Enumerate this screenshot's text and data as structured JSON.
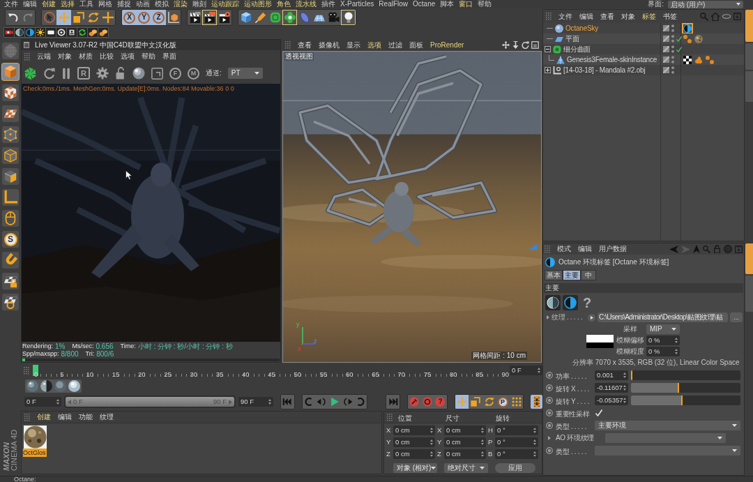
{
  "menu_bar": {
    "items": [
      {
        "label": "文件",
        "highlighted": false
      },
      {
        "label": "编辑",
        "highlighted": false
      },
      {
        "label": "创建",
        "highlighted": true
      },
      {
        "label": "选择",
        "highlighted": true
      },
      {
        "label": "工具",
        "highlighted": false
      },
      {
        "label": "网格",
        "highlighted": false
      },
      {
        "label": "捕捉",
        "highlighted": false
      },
      {
        "label": "动画",
        "highlighted": false
      },
      {
        "label": "模拟",
        "highlighted": false
      },
      {
        "label": "渲染",
        "highlighted": true
      },
      {
        "label": "雕刻",
        "highlighted": false
      },
      {
        "label": "运动跟踪",
        "highlighted": true
      },
      {
        "label": "运动图形",
        "highlighted": true
      },
      {
        "label": "角色",
        "highlighted": true
      },
      {
        "label": "流水线",
        "highlighted": true
      },
      {
        "label": "插件",
        "highlighted": false
      },
      {
        "label": "X-Particles",
        "highlighted": false
      },
      {
        "label": "RealFlow",
        "highlighted": false
      },
      {
        "label": "Octane",
        "highlighted": false
      },
      {
        "label": "脚本",
        "highlighted": false
      },
      {
        "label": "窗口",
        "highlighted": true
      },
      {
        "label": "帮助",
        "highlighted": false
      }
    ],
    "layout_label": "界面:",
    "layout_value": "启动 (用户)"
  },
  "main_toolbar": [
    {
      "selected": false,
      "highlighted": false,
      "disabled": false
    },
    {
      "selected": false,
      "highlighted": false,
      "disabled": true
    },
    {
      "selected": false,
      "highlighted": false,
      "disabled": false
    },
    {
      "selected": true,
      "highlighted": false,
      "disabled": false
    },
    {
      "selected": false,
      "highlighted": false,
      "disabled": false
    },
    {
      "selected": false,
      "highlighted": false,
      "disabled": false
    },
    {
      "selected": false,
      "highlighted": false,
      "disabled": false
    },
    {
      "label": "X",
      "selected": true,
      "highlighted": false,
      "disabled": false
    },
    {
      "label": "Y",
      "selected": true,
      "highlighted": false,
      "disabled": false
    },
    {
      "label": "Z",
      "selected": true,
      "highlighted": false,
      "disabled": false
    },
    {
      "selected": false,
      "highlighted": false,
      "disabled": false
    },
    {
      "selected": false,
      "highlighted": false,
      "disabled": false
    },
    {
      "selected": false,
      "highlighted": true,
      "disabled": false
    },
    {
      "selected": false,
      "highlighted": false,
      "disabled": false
    },
    {
      "selected": false,
      "highlighted": false,
      "disabled": false
    },
    {
      "selected": false,
      "highlighted": false,
      "disabled": false
    },
    {
      "selected": false,
      "highlighted": false,
      "disabled": false
    },
    {
      "selected": false,
      "highlighted": true,
      "disabled": false
    },
    {
      "selected": false,
      "highlighted": false,
      "disabled": false
    },
    {
      "selected": false,
      "highlighted": false,
      "disabled": false
    },
    {
      "selected": false,
      "highlighted": false,
      "disabled": false
    },
    {
      "selected": false,
      "highlighted": true,
      "disabled": false
    }
  ],
  "left_toolbar": [
    {
      "selected": false,
      "disabled": true
    },
    {
      "selected": true,
      "disabled": false
    },
    {
      "selected": false,
      "disabled": false
    },
    {
      "selected": false,
      "disabled": false
    },
    {
      "selected": false,
      "disabled": false
    },
    {
      "selected": false,
      "disabled": false
    },
    {
      "selected": false,
      "disabled": false
    },
    {
      "selected": false,
      "disabled": false
    },
    {
      "selected": false,
      "disabled": false
    },
    {
      "label": "S",
      "selected": false,
      "disabled": false
    },
    {
      "selected": false,
      "disabled": false
    },
    {
      "selected": false,
      "disabled": false
    },
    {
      "selected": false,
      "disabled": false
    }
  ],
  "live_viewer": {
    "title": "Live Viewer 3.07-R2 中国C4D联盟中文汉化版",
    "menu": [
      "云端",
      "对象",
      "材质",
      "比较",
      "选项",
      "帮助",
      "界面"
    ],
    "letter_button": "R",
    "pins": [
      "F",
      "M"
    ],
    "channel_label": "通道:",
    "channel_value": "PT",
    "status_line": "Check:0ms./1ms. MeshGen:0ms. Update[E]:0ms. Nodes:84 Movable:36  0 0",
    "stats": [
      {
        "label": "Rendering:",
        "value": "1%"
      },
      {
        "label": "Ms/sec:",
        "value": "0.656"
      },
      {
        "label": "Time:",
        "value": "小时 : 分钟 : 秒/小时 : 分钟 : 秒"
      },
      {
        "label": "Spp/maxspp:",
        "value": "8/800"
      },
      {
        "label": "Tri:",
        "value": "800/6"
      }
    ],
    "progress": {
      "level": 0.01
    }
  },
  "viewport": {
    "menu": [
      {
        "label": "查看",
        "highlighted": false
      },
      {
        "label": "摄像机",
        "highlighted": false
      },
      {
        "label": "显示",
        "highlighted": false
      },
      {
        "label": "选项",
        "highlighted": true
      },
      {
        "label": "过滤",
        "highlighted": false
      },
      {
        "label": "面板",
        "highlighted": false
      },
      {
        "label": "ProRender",
        "highlighted": true
      }
    ],
    "view_label": "透视视图",
    "grid_spacing": "网格间距 : 10 cm",
    "axis_labels": [
      "y",
      "z",
      "x"
    ]
  },
  "timeline": {
    "ticks": [
      "0",
      "5",
      "10",
      "15",
      "20",
      "25",
      "30",
      "35",
      "40",
      "45",
      "50",
      "55",
      "60",
      "65",
      "70",
      "75",
      "80",
      "85",
      "90"
    ],
    "playhead": {
      "level": 0
    },
    "frame": "0 F"
  },
  "transport": {
    "start": "0 F",
    "range": {
      "level": 1
    },
    "range_start": "0 F",
    "range_end": "90 F",
    "end": "90 F",
    "help_label": "?",
    "modes": [
      {
        "selected": true
      },
      {
        "selected": false
      },
      {
        "selected": false
      },
      {
        "label": "P",
        "selected": false
      },
      {
        "selected": false
      }
    ],
    "film": {
      "selected": true
    }
  },
  "materials": {
    "menu": [
      {
        "label": "创建",
        "highlighted": true
      },
      {
        "label": "编辑",
        "highlighted": false
      },
      {
        "label": "功能",
        "highlighted": false
      },
      {
        "label": "纹理",
        "highlighted": false
      }
    ],
    "items": [
      {
        "name": "OctGlos",
        "selected": true
      }
    ]
  },
  "coordinates": {
    "headers": [
      "位置",
      "尺寸",
      "旋转"
    ],
    "rows": [
      [
        {
          "axis": "X",
          "value": "0 cm"
        },
        {
          "axis": "X",
          "value": "0 cm"
        },
        {
          "axis": "H",
          "value": "0 °"
        }
      ],
      [
        {
          "axis": "Y",
          "value": "0 cm"
        },
        {
          "axis": "Y",
          "value": "0 cm"
        },
        {
          "axis": "P",
          "value": "0 °"
        }
      ],
      [
        {
          "axis": "Z",
          "value": "0 cm"
        },
        {
          "axis": "Z",
          "value": "0 cm"
        },
        {
          "axis": "B",
          "value": "0 °"
        }
      ]
    ],
    "mode": "对象 (相对)",
    "size_mode": "绝对尺寸",
    "apply": "应用"
  },
  "logo": {
    "brand": "MAXON",
    "product": "CINEMA 4D"
  },
  "object_manager": {
    "menu": [
      {
        "label": "文件",
        "highlighted": false
      },
      {
        "label": "编辑",
        "highlighted": false
      },
      {
        "label": "查看",
        "highlighted": false
      },
      {
        "label": "对象",
        "highlighted": false
      },
      {
        "label": "标签",
        "highlighted": true
      },
      {
        "label": "书签",
        "highlighted": false
      }
    ],
    "objects": [
      {
        "name": "OctaneSky",
        "kind": "sky",
        "selected": true,
        "checked": false,
        "tags": [
          {
            "kind": "environment",
            "selected": true
          }
        ]
      },
      {
        "name": "平面",
        "kind": "plane",
        "selected": false,
        "checked": true,
        "tags": [
          {
            "kind": "dots",
            "selected": false
          },
          {
            "kind": "material",
            "selected": false
          }
        ]
      },
      {
        "name": "细分曲面",
        "kind": "subdivision",
        "selected": false,
        "checked": true,
        "expanded": true,
        "children": [
          {
            "name": "Genesis3Female-skinInstance",
            "kind": "polygon",
            "selected": false,
            "checked": false,
            "tags": [
              {
                "kind": "checker",
                "selected": false
              },
              {
                "kind": "blob",
                "selected": false
              },
              {
                "kind": "dots",
                "selected": false
              }
            ]
          }
        ]
      },
      {
        "name": "[14-03-18] - Mandala #2.obj",
        "kind": "null",
        "selected": false,
        "checked": false,
        "expanded": false
      }
    ]
  },
  "attributes": {
    "menu": [
      "模式",
      "编辑",
      "用户数据"
    ],
    "title": "Octane 环境标签 [Octane 环境标签]",
    "tabs": [
      {
        "label": "基本",
        "selected": false
      },
      {
        "label": "主要",
        "selected": true
      },
      {
        "label": "中",
        "selected": false
      }
    ],
    "section": "主要",
    "help": "?",
    "texture": {
      "label": "纹理 . . . . .",
      "path": "C:\\Users\\Administrator\\Desktop\\贴图纹理\\贴",
      "button": "..."
    },
    "sampling": {
      "label": "采样",
      "value": "MIP"
    },
    "blur_offset": {
      "label": "模糊偏移",
      "value": "0 %"
    },
    "blur_amount": {
      "label": "模糊程度",
      "value": "0 %"
    },
    "resolution": "分辨率 7070 x 3535, RGB (32 位), Linear Color Space",
    "params": [
      {
        "kind": "slider",
        "label": "功率 . . . . .",
        "value": "0.001",
        "level": 0
      },
      {
        "kind": "slider",
        "label": "旋转 X . . . .",
        "value": "-0.11607",
        "level": 0.44
      },
      {
        "kind": "slider",
        "label": "旋转 Y . . . .",
        "value": "-0.05357",
        "level": 0.47
      },
      {
        "kind": "checkbox",
        "label": "重要性采样",
        "checked": true
      },
      {
        "kind": "dropdown",
        "label": "类型 . . . . .",
        "value": "主要环境"
      },
      {
        "kind": "group",
        "label": "AO 环境纹理"
      },
      {
        "kind": "dropdown",
        "label": "类型 . . . . ."
      }
    ]
  },
  "side_tabs": {
    "top": [
      {
        "selected": true
      },
      {
        "selected": false
      },
      {
        "selected": false
      }
    ],
    "bottom": [
      {
        "selected": true
      },
      {
        "selected": false
      }
    ]
  },
  "status_bar": "Octane:"
}
